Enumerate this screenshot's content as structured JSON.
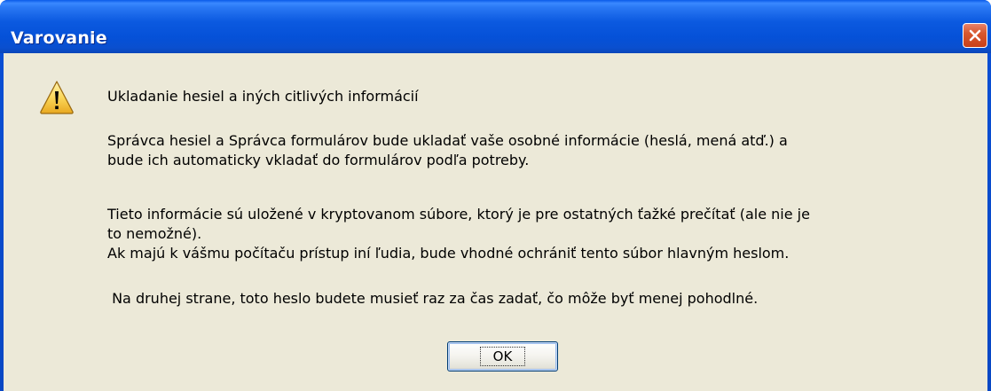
{
  "window": {
    "title": "Varovanie"
  },
  "dialog": {
    "heading": "Ukladanie hesiel a iných citlivých informácií",
    "paragraph1_line1": "Správca hesiel a Správca formulárov bude ukladať vaše osobné informácie (heslá, mená atď.) a",
    "paragraph1_line2": "bude ich automaticky vkladať do formulárov podľa potreby.",
    "paragraph2_line1": "Tieto informácie sú uložené v kryptovanom súbore, ktorý je pre ostatných ťažké prečítať (ale nie je",
    "paragraph2_line2": "to nemožné).",
    "paragraph2_line3": "Ak majú k vášmu počítaču prístup iní ľudia, bude vhodné ochrániť tento súbor hlavným heslom.",
    "paragraph3": " Na druhej strane, toto heslo budete musieť raz za čas zadať, čo môže byť menej pohodlné.",
    "ok_label": "OK"
  },
  "icons": {
    "dialog_icon": "warning-icon",
    "close_icon": "close-icon"
  },
  "colors": {
    "titlebar": "#0a5ae8",
    "client": "#ece9d8",
    "close_button": "#d8582f",
    "warning_fill": "#fbd75a"
  }
}
